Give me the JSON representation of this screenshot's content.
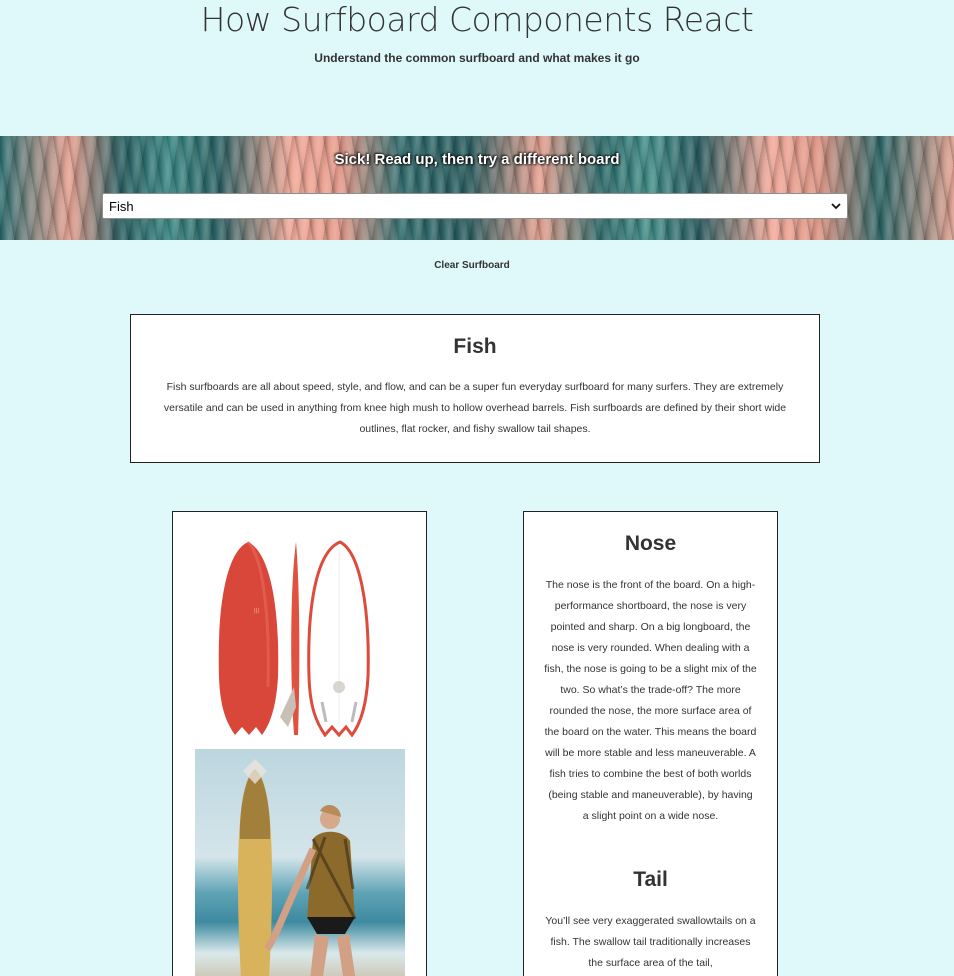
{
  "header": {
    "title": "How Surfboard Components React",
    "subtitle": "Understand the common surfboard and what makes it go"
  },
  "banner": {
    "heading": "Sick! Read up, then try a different board",
    "select_value": "Fish"
  },
  "controls": {
    "clear_label": "Clear Surfboard"
  },
  "board": {
    "name": "Fish",
    "description": "Fish surfboards are all about speed, style, and flow, and can be a super fun everyday surfboard for many surfers. They are extremely versatile and can be used in anything from knee high mush to hollow overhead barrels. Fish surfboards are defined by their short wide outlines, flat rocker, and fishy swallow tail shapes."
  },
  "parts": [
    {
      "title": "Nose",
      "description": "The nose is the front of the board. On a high-performance shortboard, the nose is very pointed and sharp. On a big longboard, the nose is very rounded. When dealing with a fish, the nose is going to be a slight mix of the two. So what’s the trade-off? The more rounded the nose, the more surface area of the board on the water. This means the board will be more stable and less maneuverable. A fish tries to combine the best of both worlds (being stable and maneuverable), by having a slight point on a wide nose."
    },
    {
      "title": "Tail",
      "description": "You’ll see very exaggerated swallowtails on a fish. The swallow tail traditionally increases the surface area of the tail,"
    }
  ],
  "colors": {
    "page_background": "#dff9fb",
    "board_red": "#d9473a",
    "card_border": "#222222"
  }
}
